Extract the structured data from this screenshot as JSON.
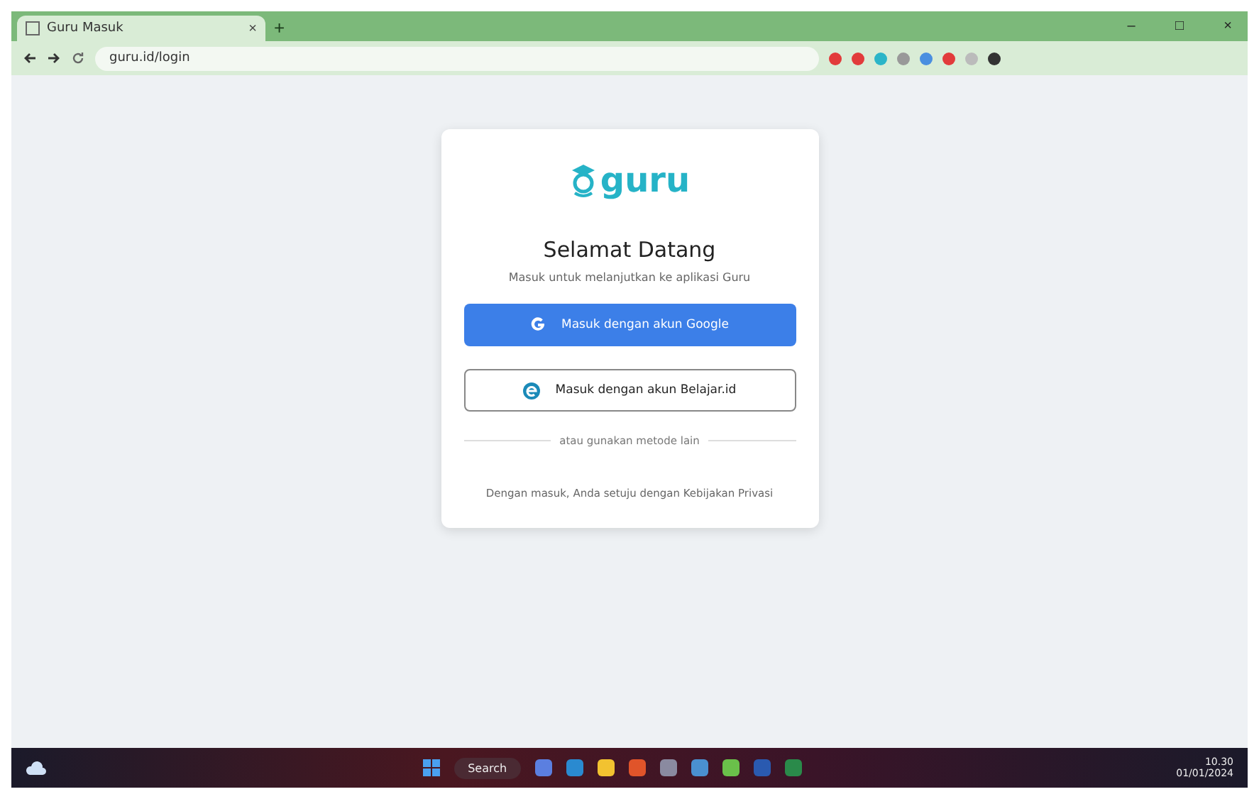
{
  "browser": {
    "tab_title": "Guru Masuk",
    "tab_close": "×",
    "new_tab": "+",
    "address": "guru.id/login",
    "window_controls": [
      "–",
      "□",
      "×"
    ]
  },
  "login": {
    "brand": "guru",
    "title": "Selamat Datang",
    "subtitle": "Masuk untuk melanjutkan ke aplikasi Guru",
    "buttons": [
      {
        "kind": "google",
        "label": "Masuk dengan akun Google"
      },
      {
        "kind": "edge",
        "label": "Masuk dengan akun Belajar.id"
      }
    ],
    "divider": "atau gunakan metode lain",
    "footer": "Dengan masuk, Anda setuju dengan Kebijakan Privasi"
  },
  "taskbar": {
    "search": "Search",
    "clock_time": "10.30",
    "clock_date": "01/01/2024"
  }
}
